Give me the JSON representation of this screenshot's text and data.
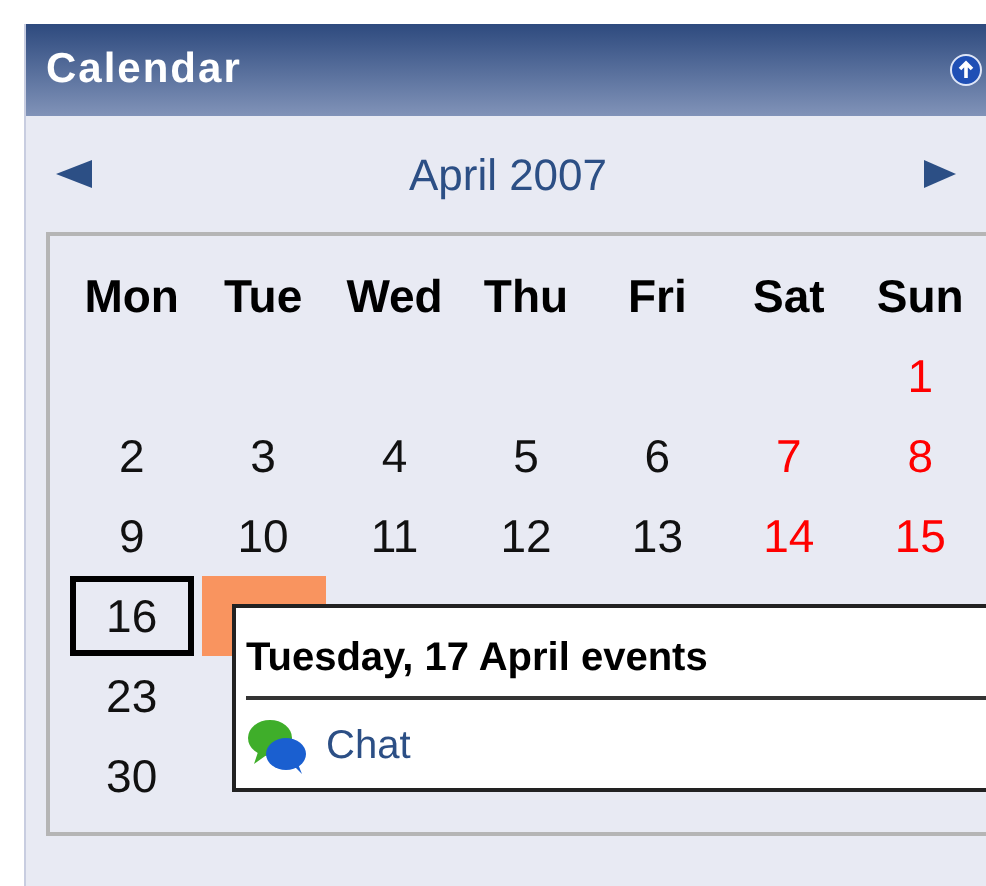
{
  "block": {
    "title": "Calendar"
  },
  "nav": {
    "month": "April 2007"
  },
  "weekdays": [
    "Mon",
    "Tue",
    "Wed",
    "Thu",
    "Fri",
    "Sat",
    "Sun"
  ],
  "weeks": [
    [
      {
        "kind": "blank"
      },
      {
        "kind": "blank"
      },
      {
        "kind": "blank"
      },
      {
        "kind": "blank"
      },
      {
        "kind": "blank"
      },
      {
        "kind": "blank"
      },
      {
        "kind": "day",
        "text": "1",
        "weekend": true,
        "today": false,
        "event": false
      }
    ],
    [
      {
        "kind": "day",
        "text": "2",
        "weekend": false,
        "today": false,
        "event": false
      },
      {
        "kind": "day",
        "text": "3",
        "weekend": false,
        "today": false,
        "event": false
      },
      {
        "kind": "day",
        "text": "4",
        "weekend": false,
        "today": false,
        "event": false
      },
      {
        "kind": "day",
        "text": "5",
        "weekend": false,
        "today": false,
        "event": false
      },
      {
        "kind": "day",
        "text": "6",
        "weekend": false,
        "today": false,
        "event": false
      },
      {
        "kind": "day",
        "text": "7",
        "weekend": true,
        "today": false,
        "event": false
      },
      {
        "kind": "day",
        "text": "8",
        "weekend": true,
        "today": false,
        "event": false
      }
    ],
    [
      {
        "kind": "day",
        "text": "9",
        "weekend": false,
        "today": false,
        "event": false
      },
      {
        "kind": "day",
        "text": "10",
        "weekend": false,
        "today": false,
        "event": false
      },
      {
        "kind": "day",
        "text": "11",
        "weekend": false,
        "today": false,
        "event": false
      },
      {
        "kind": "day",
        "text": "12",
        "weekend": false,
        "today": false,
        "event": false
      },
      {
        "kind": "day",
        "text": "13",
        "weekend": false,
        "today": false,
        "event": false
      },
      {
        "kind": "day",
        "text": "14",
        "weekend": true,
        "today": false,
        "event": false
      },
      {
        "kind": "day",
        "text": "15",
        "weekend": true,
        "today": false,
        "event": false
      }
    ],
    [
      {
        "kind": "day",
        "text": "16",
        "weekend": false,
        "today": true,
        "event": false
      },
      {
        "kind": "day",
        "weekend": false,
        "today": false,
        "event": true
      }
    ],
    [
      {
        "kind": "day",
        "text": "23",
        "weekend": false,
        "today": false,
        "event": false
      }
    ],
    [
      {
        "kind": "day",
        "text": "30",
        "weekend": false,
        "today": false,
        "event": false
      }
    ]
  ],
  "popup": {
    "title": "Tuesday, 17 April events",
    "events": [
      {
        "label": "Chat"
      }
    ]
  }
}
